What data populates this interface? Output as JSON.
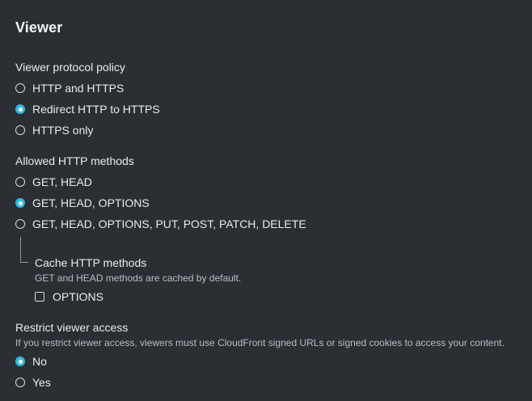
{
  "section": {
    "title": "Viewer"
  },
  "viewer_protocol_policy": {
    "label": "Viewer protocol policy",
    "options": [
      "HTTP and HTTPS",
      "Redirect HTTP to HTTPS",
      "HTTPS only"
    ],
    "selected": "Redirect HTTP to HTTPS"
  },
  "allowed_http_methods": {
    "label": "Allowed HTTP methods",
    "options": [
      "GET, HEAD",
      "GET, HEAD, OPTIONS",
      "GET, HEAD, OPTIONS, PUT, POST, PATCH, DELETE"
    ],
    "selected": "GET, HEAD, OPTIONS"
  },
  "cache_http_methods": {
    "label": "Cache HTTP methods",
    "description": "GET and HEAD methods are cached by default.",
    "checkbox_label": "OPTIONS",
    "checked": false
  },
  "restrict_viewer_access": {
    "label": "Restrict viewer access",
    "description": "If you restrict viewer access, viewers must use CloudFront signed URLs or signed cookies to access your content.",
    "options": [
      "No",
      "Yes"
    ],
    "selected": "No"
  },
  "colors": {
    "background": "#2b2f33",
    "accent": "#33b8e6",
    "text": "#e9ebed",
    "muted": "#b6bec9"
  }
}
